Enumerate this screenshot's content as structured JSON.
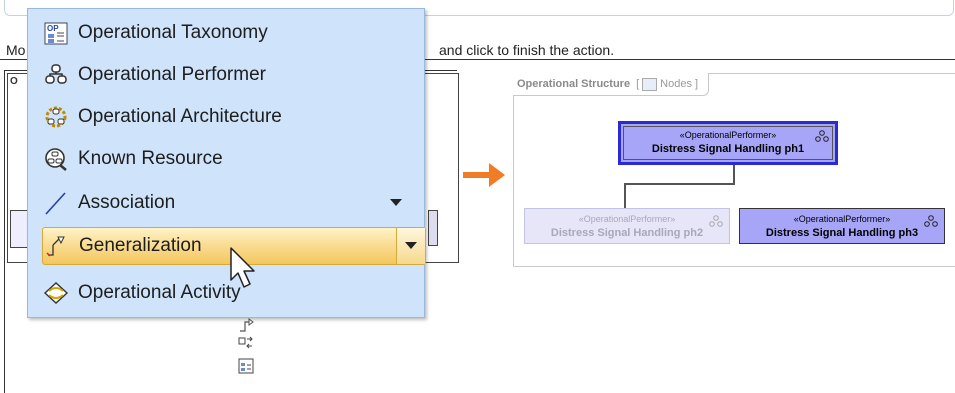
{
  "instruction": {
    "head": "Mo",
    "tail": "and click to finish the action."
  },
  "left_diagram": {
    "frame_label": "O"
  },
  "palette": {
    "items": [
      {
        "label": "Operational Taxonomy",
        "icon": "taxonomy-icon"
      },
      {
        "label": "Operational Performer",
        "icon": "performer-icon"
      },
      {
        "label": "Operational Architecture",
        "icon": "architecture-icon"
      },
      {
        "label": "Known Resource",
        "icon": "known-resource-icon"
      },
      {
        "label": "Association",
        "icon": "association-line-icon",
        "has_dropdown": true
      },
      {
        "label": "Generalization",
        "icon": "generalization-arrow-icon",
        "has_dropdown": true,
        "selected": true
      },
      {
        "label": "Operational Activity",
        "icon": "activity-icon"
      }
    ]
  },
  "diagram": {
    "tab_title": "Operational Structure",
    "tab_nodes_label": "Nodes",
    "nodes": [
      {
        "stereotype": "«OperationalPerformer»",
        "name": "Distress Signal Handling ph1",
        "state": "selected"
      },
      {
        "stereotype": "«OperationalPerformer»",
        "name": "Distress Signal Handling ph2",
        "state": "faded"
      },
      {
        "stereotype": "«OperationalPerformer»",
        "name": "Distress Signal Handling ph3",
        "state": "normal"
      }
    ]
  },
  "colors": {
    "palette_bg": "#cfe3fb",
    "selected_item": "#f9d98a",
    "node_fill": "#a7a5f8",
    "node_selected_border": "#2b2bd6",
    "arrow": "#f07c26"
  }
}
